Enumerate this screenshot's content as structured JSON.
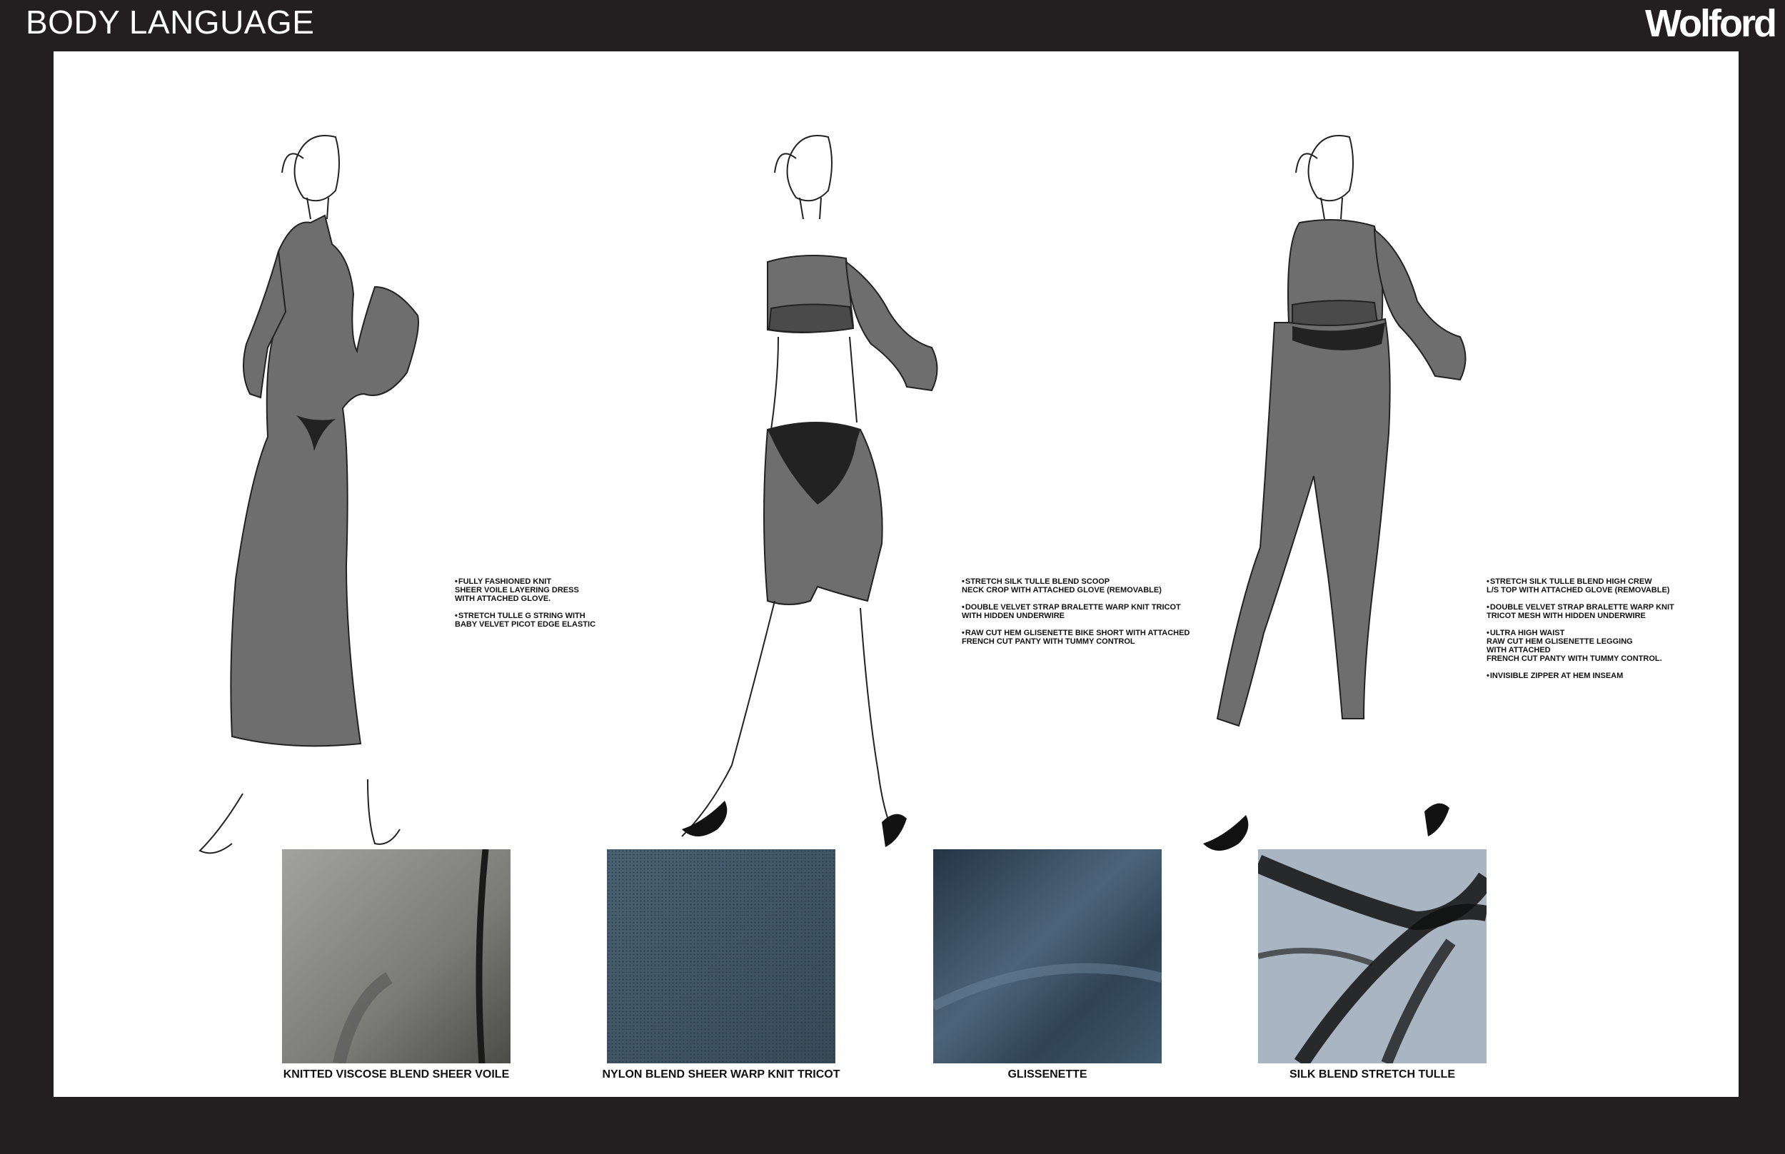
{
  "header": {
    "title": "BODY LANGUAGE",
    "brand": "Wolford"
  },
  "looks": [
    {
      "notes": [
        "FULLY FASHIONED KNIT\nSHEER VOILE LAYERING DRESS\nWITH ATTACHED GLOVE.",
        "STRETCH TULLE G STRING WITH\nBABY VELVET PICOT EDGE ELASTIC"
      ]
    },
    {
      "notes": [
        "STRETCH SILK TULLE BLEND SCOOP\nNECK CROP WITH ATTACHED GLOVE (REMOVABLE)",
        "DOUBLE VELVET STRAP BRALETTE WARP KNIT TRICOT\nWITH HIDDEN UNDERWIRE",
        "RAW CUT HEM GLISENETTE BIKE SHORT WITH ATTACHED\nFRENCH CUT PANTY WITH TUMMY CONTROL"
      ]
    },
    {
      "notes": [
        "STRETCH SILK TULLE BLEND HIGH CREW\nL/S TOP WITH ATTACHED GLOVE (REMOVABLE)",
        "DOUBLE VELVET STRAP BRALETTE WARP KNIT\nTRICOT MESH WITH HIDDEN UNDERWIRE",
        "ULTRA HIGH WAIST\nRAW CUT HEM GLISENETTE LEGGING\nWITH ATTACHED\nFRENCH CUT PANTY WITH TUMMY CONTROL.",
        "INVISIBLE ZIPPER AT HEM INSEAM"
      ]
    }
  ],
  "swatches": [
    {
      "label": "KNITTED VISCOSE BLEND SHEER VOILE",
      "color": "#8a8a86"
    },
    {
      "label": "NYLON BLEND SHEER WARP KNIT TRICOT",
      "color": "#3f5564"
    },
    {
      "label": "GLISSENETTE",
      "color": "#35495c"
    },
    {
      "label": "SILK BLEND STRETCH TULLE",
      "color": "#a9b6c1"
    }
  ]
}
